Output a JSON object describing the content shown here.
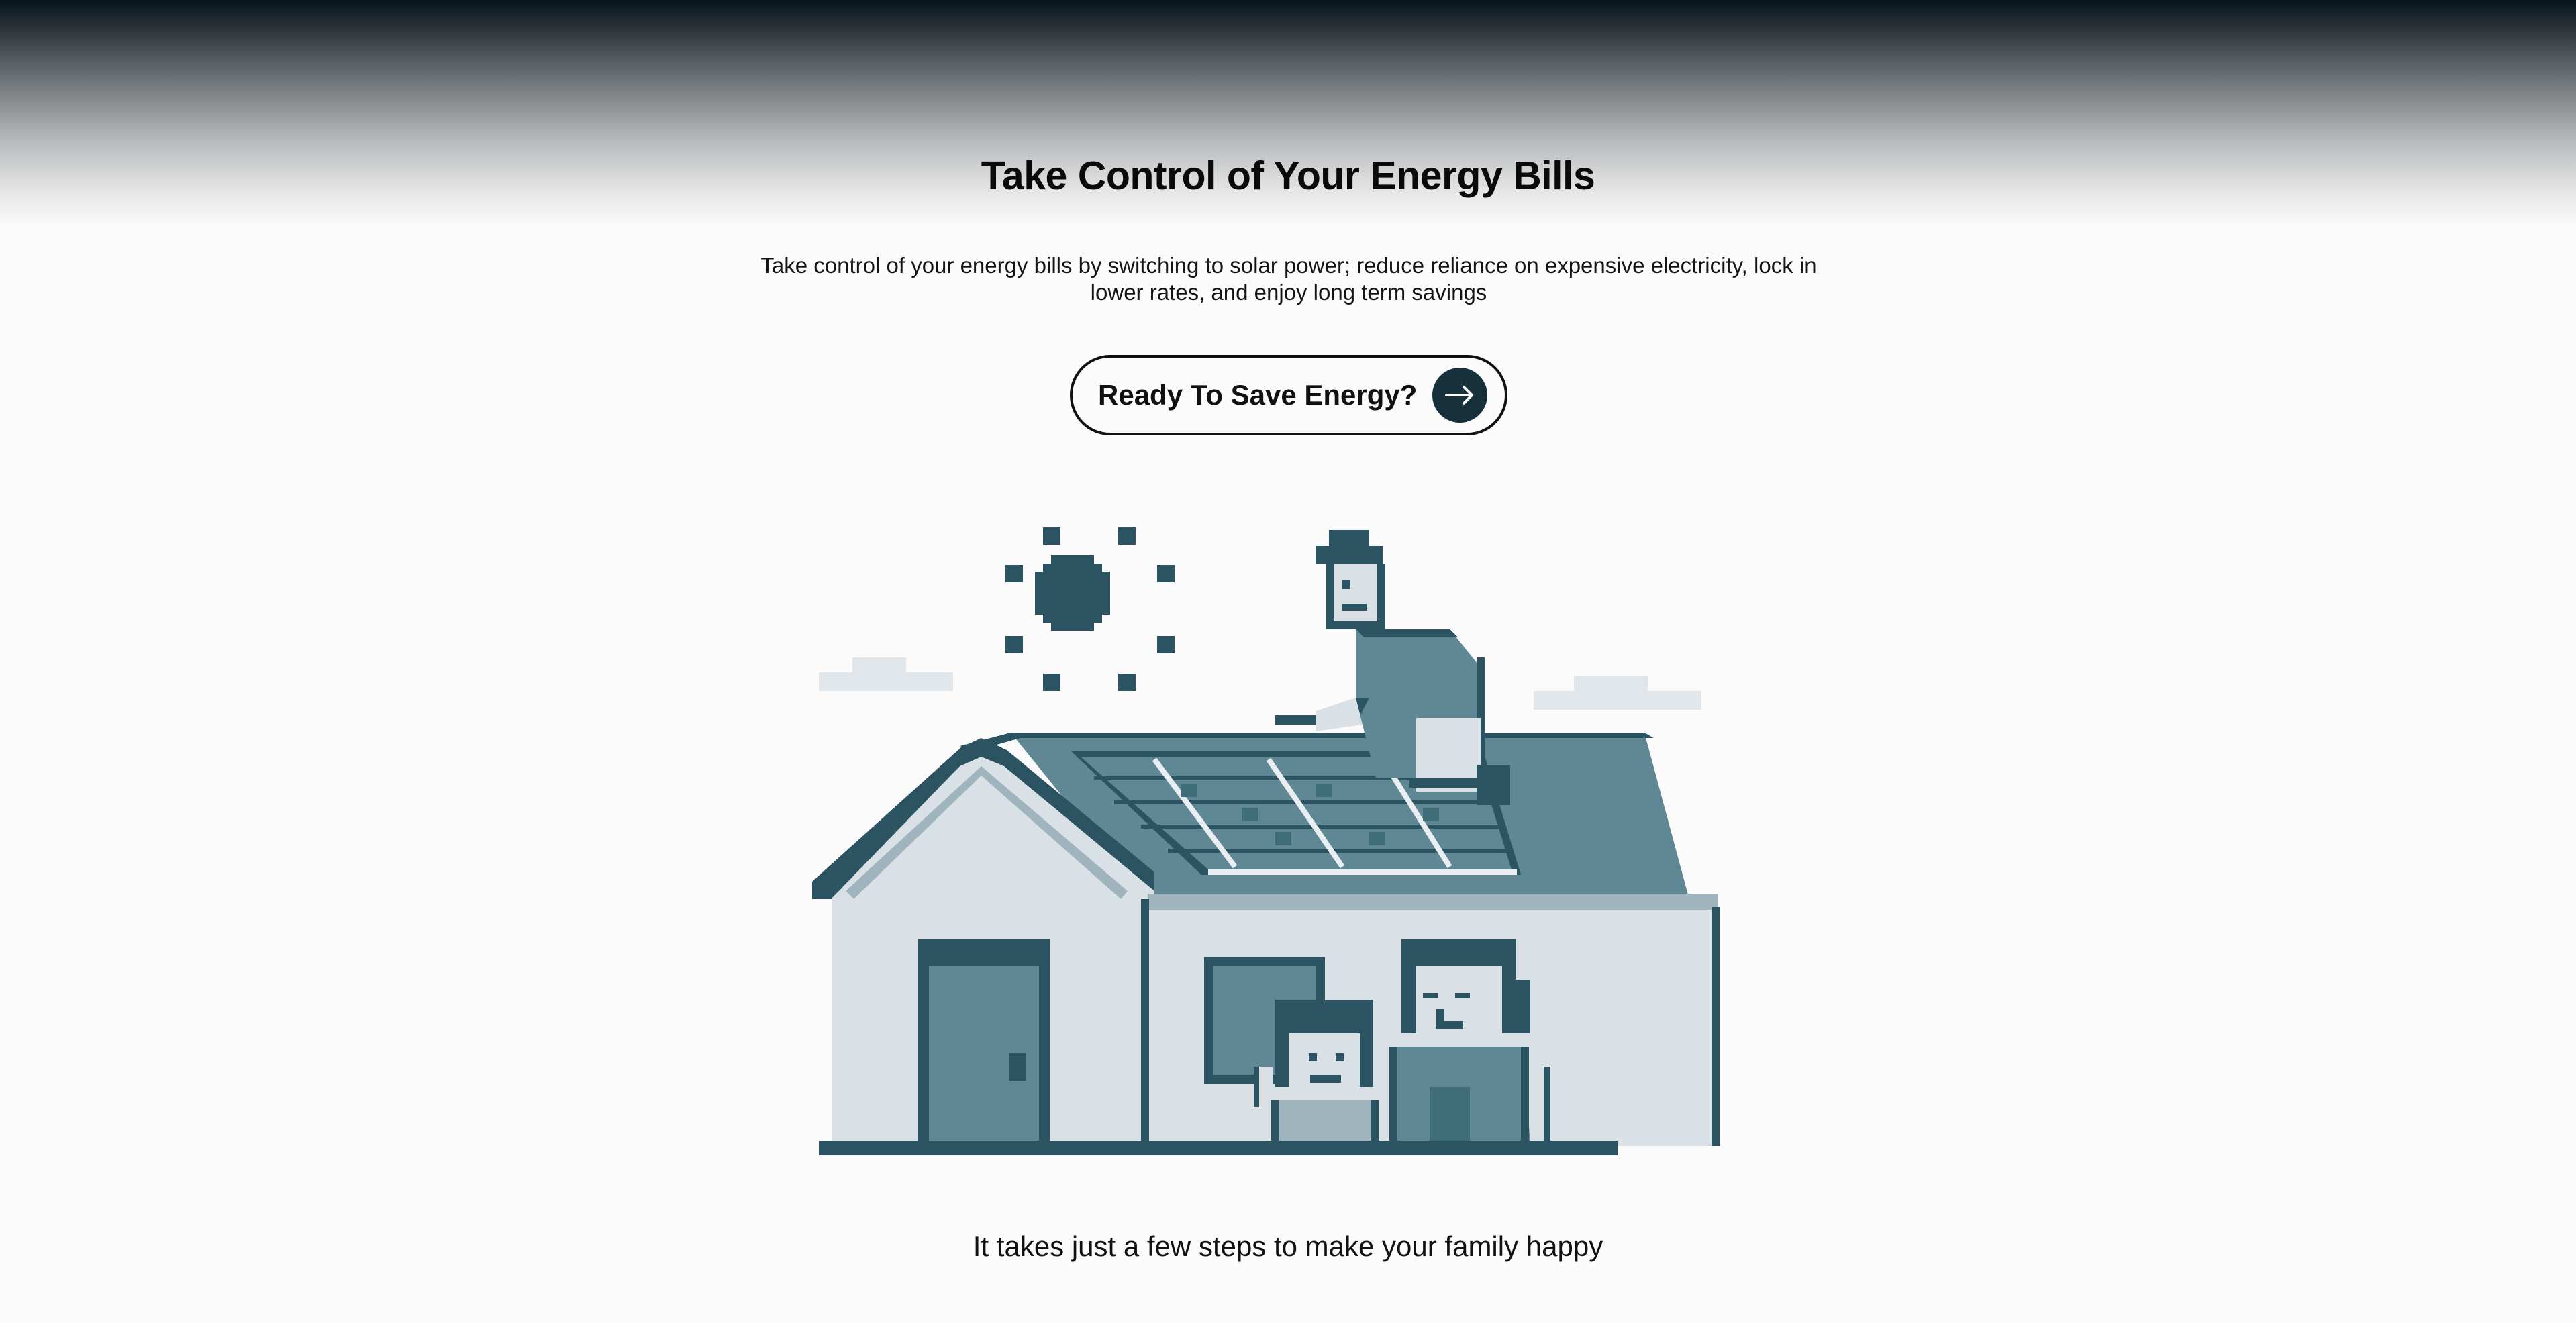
{
  "hero": {
    "title": "Take Control of Your Energy Bills",
    "subtitle": "Take control of your energy bills by switching to solar power; reduce reliance on expensive electricity, lock in lower rates, and enjoy long term savings",
    "cta_label": "Ready To Save Energy?",
    "cta_icon": "arrow-right-icon"
  },
  "illustration": {
    "subject": "pixel-art-house-with-solar-panels-and-family",
    "colors": {
      "dark": "#2b5361",
      "mid": "#5f8894",
      "light": "#d9e1e6",
      "cloud": "#e1e6ea",
      "panel_line": "#e8eef1"
    }
  },
  "tagline": "It takes just a few steps to make your family happy",
  "colors": {
    "background": "#fbfbfb",
    "gradient_top": "#07141c",
    "accent": "#16303c",
    "text": "#0b0b0b"
  }
}
